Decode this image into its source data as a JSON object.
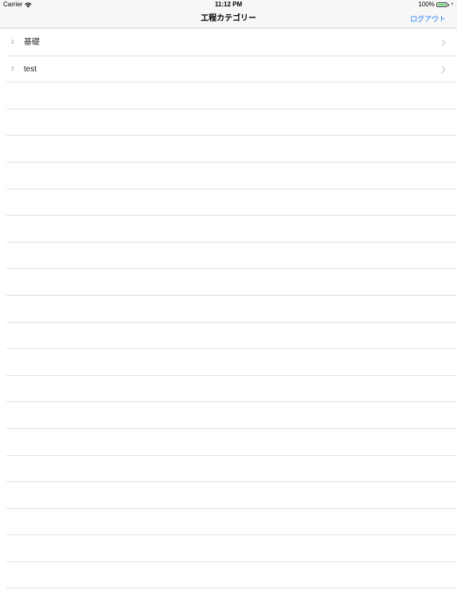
{
  "status": {
    "carrier": "Carrier",
    "time": "11:12 PM",
    "battery": "100%",
    "wifi_icon": "wifi-icon",
    "battery_icon": "battery-icon"
  },
  "nav": {
    "title": "工程カテゴリー",
    "logout_label": "ログアウト"
  },
  "list": {
    "rows": [
      {
        "index": "1",
        "label": "基礎"
      },
      {
        "index": "2",
        "label": "test"
      }
    ]
  },
  "colors": {
    "accent": "#1a7cf5",
    "battery_green": "#4cd964"
  }
}
